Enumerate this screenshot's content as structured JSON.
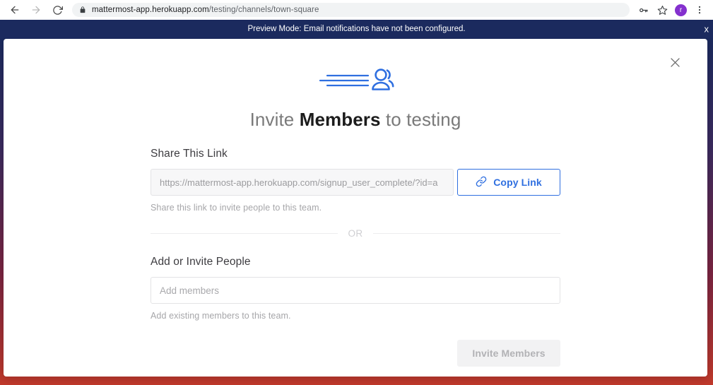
{
  "browser": {
    "back_label": "back-arrow",
    "forward_label": "forward-arrow",
    "reload_label": "reload",
    "url_host": "mattermost-app.herokuapp.com",
    "url_path": "/testing/channels/town-square",
    "lock_icon": "lock-icon",
    "key_icon": "key-icon",
    "star_icon": "star-icon",
    "menu_icon": "three-dot-menu-icon",
    "profile_initial": "r"
  },
  "banner": {
    "message": "Preview Mode: Email notifications have not been configured.",
    "close_label": "x",
    "background": "#1b2a5e"
  },
  "modal": {
    "close_label": "✕",
    "header_icon": "invite-members-icon",
    "title_prefix": "Invite ",
    "title_bold": "Members",
    "title_suffix": " to testing",
    "share_section": {
      "label": "Share This Link",
      "link_value": "https://mattermost-app.herokuapp.com/signup_user_complete/?id=a",
      "copy_button_label": "Copy Link",
      "copy_button_icon": "link-chain-icon",
      "helper_text": "Share this link to invite people to this team."
    },
    "divider_label": "OR",
    "add_section": {
      "label": "Add or Invite People",
      "input_placeholder": "Add members",
      "input_value": "",
      "helper_text": "Add existing members to this team."
    },
    "invite_button_label": "Invite Members"
  },
  "colors": {
    "accent_blue": "#2f6fe0",
    "banner_navy": "#1b2a5e",
    "disabled_gray": "#b2b2b5"
  }
}
